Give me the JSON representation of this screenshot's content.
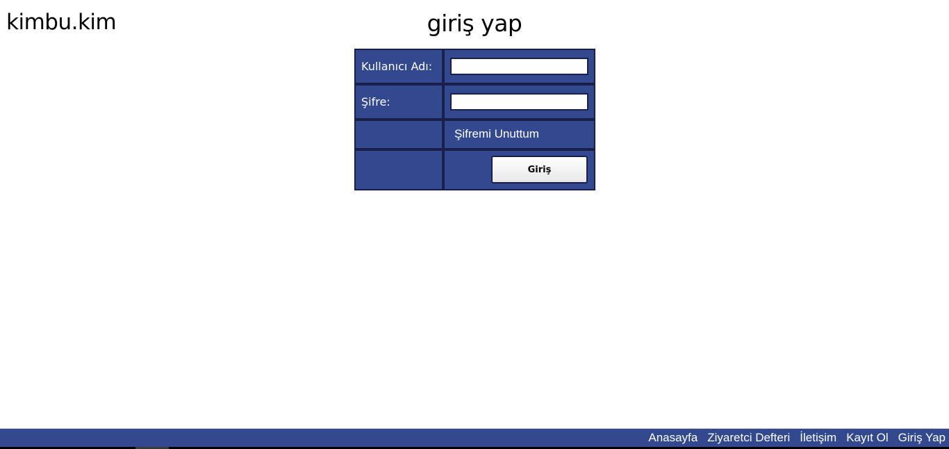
{
  "header": {
    "logo": "kimbu.kim",
    "title": "giriş yap"
  },
  "login_form": {
    "username_label": "Kullanıcı Adı:",
    "username_value": "",
    "password_label": "Şifre:",
    "password_value": "",
    "forgot_link": "Şifremi Unuttum",
    "submit_label": "Giriş"
  },
  "footer": {
    "nav": [
      {
        "label": "Anasayfa"
      },
      {
        "label": "Ziyaretci Defteri"
      },
      {
        "label": "İletişim"
      },
      {
        "label": "Kayıt Ol"
      },
      {
        "label": "Giriş Yap"
      }
    ]
  },
  "colors": {
    "panel": "#33498f",
    "panel_border": "#1a1f4a",
    "footer": "#33498f"
  }
}
